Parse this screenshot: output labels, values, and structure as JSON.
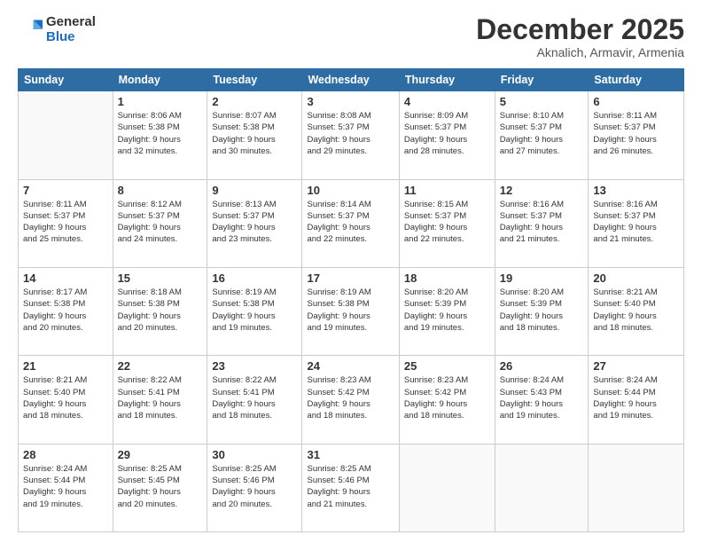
{
  "header": {
    "logo_general": "General",
    "logo_blue": "Blue",
    "month": "December 2025",
    "location": "Aknalich, Armavir, Armenia"
  },
  "weekdays": [
    "Sunday",
    "Monday",
    "Tuesday",
    "Wednesday",
    "Thursday",
    "Friday",
    "Saturday"
  ],
  "weeks": [
    [
      {
        "day": "",
        "info": ""
      },
      {
        "day": "1",
        "info": "Sunrise: 8:06 AM\nSunset: 5:38 PM\nDaylight: 9 hours\nand 32 minutes."
      },
      {
        "day": "2",
        "info": "Sunrise: 8:07 AM\nSunset: 5:38 PM\nDaylight: 9 hours\nand 30 minutes."
      },
      {
        "day": "3",
        "info": "Sunrise: 8:08 AM\nSunset: 5:37 PM\nDaylight: 9 hours\nand 29 minutes."
      },
      {
        "day": "4",
        "info": "Sunrise: 8:09 AM\nSunset: 5:37 PM\nDaylight: 9 hours\nand 28 minutes."
      },
      {
        "day": "5",
        "info": "Sunrise: 8:10 AM\nSunset: 5:37 PM\nDaylight: 9 hours\nand 27 minutes."
      },
      {
        "day": "6",
        "info": "Sunrise: 8:11 AM\nSunset: 5:37 PM\nDaylight: 9 hours\nand 26 minutes."
      }
    ],
    [
      {
        "day": "7",
        "info": "Sunrise: 8:11 AM\nSunset: 5:37 PM\nDaylight: 9 hours\nand 25 minutes."
      },
      {
        "day": "8",
        "info": "Sunrise: 8:12 AM\nSunset: 5:37 PM\nDaylight: 9 hours\nand 24 minutes."
      },
      {
        "day": "9",
        "info": "Sunrise: 8:13 AM\nSunset: 5:37 PM\nDaylight: 9 hours\nand 23 minutes."
      },
      {
        "day": "10",
        "info": "Sunrise: 8:14 AM\nSunset: 5:37 PM\nDaylight: 9 hours\nand 22 minutes."
      },
      {
        "day": "11",
        "info": "Sunrise: 8:15 AM\nSunset: 5:37 PM\nDaylight: 9 hours\nand 22 minutes."
      },
      {
        "day": "12",
        "info": "Sunrise: 8:16 AM\nSunset: 5:37 PM\nDaylight: 9 hours\nand 21 minutes."
      },
      {
        "day": "13",
        "info": "Sunrise: 8:16 AM\nSunset: 5:37 PM\nDaylight: 9 hours\nand 21 minutes."
      }
    ],
    [
      {
        "day": "14",
        "info": "Sunrise: 8:17 AM\nSunset: 5:38 PM\nDaylight: 9 hours\nand 20 minutes."
      },
      {
        "day": "15",
        "info": "Sunrise: 8:18 AM\nSunset: 5:38 PM\nDaylight: 9 hours\nand 20 minutes."
      },
      {
        "day": "16",
        "info": "Sunrise: 8:19 AM\nSunset: 5:38 PM\nDaylight: 9 hours\nand 19 minutes."
      },
      {
        "day": "17",
        "info": "Sunrise: 8:19 AM\nSunset: 5:38 PM\nDaylight: 9 hours\nand 19 minutes."
      },
      {
        "day": "18",
        "info": "Sunrise: 8:20 AM\nSunset: 5:39 PM\nDaylight: 9 hours\nand 19 minutes."
      },
      {
        "day": "19",
        "info": "Sunrise: 8:20 AM\nSunset: 5:39 PM\nDaylight: 9 hours\nand 18 minutes."
      },
      {
        "day": "20",
        "info": "Sunrise: 8:21 AM\nSunset: 5:40 PM\nDaylight: 9 hours\nand 18 minutes."
      }
    ],
    [
      {
        "day": "21",
        "info": "Sunrise: 8:21 AM\nSunset: 5:40 PM\nDaylight: 9 hours\nand 18 minutes."
      },
      {
        "day": "22",
        "info": "Sunrise: 8:22 AM\nSunset: 5:41 PM\nDaylight: 9 hours\nand 18 minutes."
      },
      {
        "day": "23",
        "info": "Sunrise: 8:22 AM\nSunset: 5:41 PM\nDaylight: 9 hours\nand 18 minutes."
      },
      {
        "day": "24",
        "info": "Sunrise: 8:23 AM\nSunset: 5:42 PM\nDaylight: 9 hours\nand 18 minutes."
      },
      {
        "day": "25",
        "info": "Sunrise: 8:23 AM\nSunset: 5:42 PM\nDaylight: 9 hours\nand 18 minutes."
      },
      {
        "day": "26",
        "info": "Sunrise: 8:24 AM\nSunset: 5:43 PM\nDaylight: 9 hours\nand 19 minutes."
      },
      {
        "day": "27",
        "info": "Sunrise: 8:24 AM\nSunset: 5:44 PM\nDaylight: 9 hours\nand 19 minutes."
      }
    ],
    [
      {
        "day": "28",
        "info": "Sunrise: 8:24 AM\nSunset: 5:44 PM\nDaylight: 9 hours\nand 19 minutes."
      },
      {
        "day": "29",
        "info": "Sunrise: 8:25 AM\nSunset: 5:45 PM\nDaylight: 9 hours\nand 20 minutes."
      },
      {
        "day": "30",
        "info": "Sunrise: 8:25 AM\nSunset: 5:46 PM\nDaylight: 9 hours\nand 20 minutes."
      },
      {
        "day": "31",
        "info": "Sunrise: 8:25 AM\nSunset: 5:46 PM\nDaylight: 9 hours\nand 21 minutes."
      },
      {
        "day": "",
        "info": ""
      },
      {
        "day": "",
        "info": ""
      },
      {
        "day": "",
        "info": ""
      }
    ]
  ]
}
